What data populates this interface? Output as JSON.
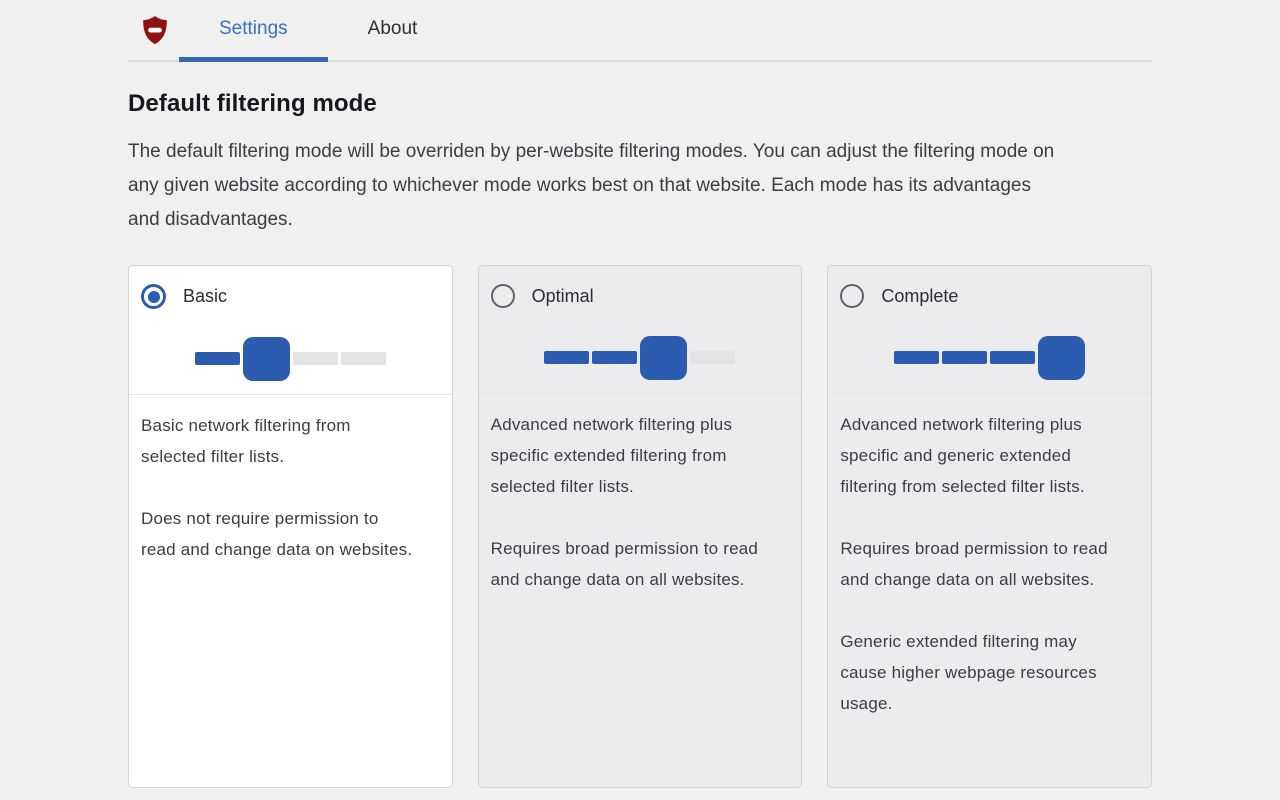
{
  "header": {
    "logo_icon": "ublock-origin-lite-shield",
    "tabs": [
      {
        "label": "Settings",
        "active": true
      },
      {
        "label": "About",
        "active": false
      }
    ]
  },
  "page": {
    "title": "Default filtering mode",
    "description": "The default filtering mode will be overriden by per-website filtering modes. You can adjust the filtering mode on any given website according to whichever mode works best on that website. Each mode has its advantages and disadvantages."
  },
  "modes": [
    {
      "label": "Basic",
      "selected": true,
      "slider_value": 1,
      "slider_max": 3,
      "paragraphs": [
        "Basic network filtering from selected filter lists.",
        "Does not require permission to read and change data on websites."
      ]
    },
    {
      "label": "Optimal",
      "selected": false,
      "slider_value": 2,
      "slider_max": 3,
      "paragraphs": [
        "Advanced network filtering plus specific extended filtering from selected filter lists.",
        "Requires broad permission to read and change data on all websites."
      ]
    },
    {
      "label": "Complete",
      "selected": false,
      "slider_value": 3,
      "slider_max": 3,
      "paragraphs": [
        "Advanced network filtering plus specific and generic extended filtering from selected filter lists.",
        "Requires broad permission to read and change data on all websites.",
        "Generic extended filtering may cause higher webpage resources usage."
      ]
    }
  ],
  "colors": {
    "accent_blue": "#3a70c4",
    "control_blue": "#2b5cb0",
    "shield_red": "#8f1111",
    "page_bg": "#f0f0f1",
    "card_selected_bg": "#ffffff",
    "card_bg": "#ececee",
    "track_gray": "#e3e3e5"
  }
}
